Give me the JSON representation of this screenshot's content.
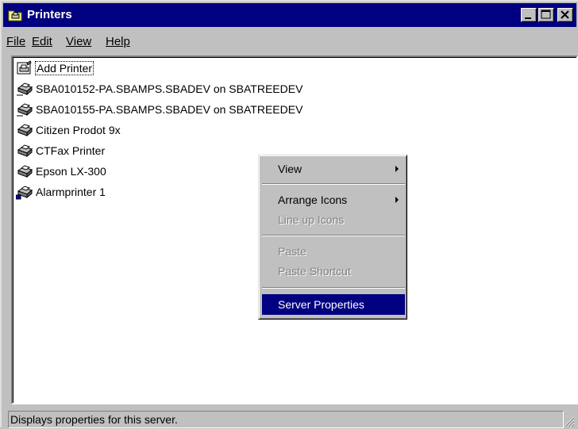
{
  "window": {
    "title": "Printers"
  },
  "menu": {
    "file": "File",
    "edit": "Edit",
    "view": "View",
    "help": "Help"
  },
  "printers": [
    {
      "label": "Add Printer",
      "icon": "add-printer-icon"
    },
    {
      "label": "SBA010152-PA.SBAMPS.SBADEV on SBATREEDEV",
      "icon": "network-printer-icon"
    },
    {
      "label": "SBA010155-PA.SBAMPS.SBADEV on SBATREEDEV",
      "icon": "network-printer-icon"
    },
    {
      "label": "Citizen Prodot 9x",
      "icon": "printer-icon"
    },
    {
      "label": "CTFax Printer",
      "icon": "printer-icon"
    },
    {
      "label": "Epson LX-300",
      "icon": "printer-icon"
    },
    {
      "label": "Alarmprinter 1",
      "icon": "network-printer-icon"
    }
  ],
  "context_menu": {
    "view": "View",
    "arrange_icons": "Arrange Icons",
    "line_up_icons": "Line up Icons",
    "paste": "Paste",
    "paste_shortcut": "Paste Shortcut",
    "server_properties": "Server Properties"
  },
  "status": {
    "text": "Displays properties for this server."
  },
  "colors": {
    "titlebar": "#000080",
    "face": "#c0c0c0",
    "selection": "#000080"
  }
}
